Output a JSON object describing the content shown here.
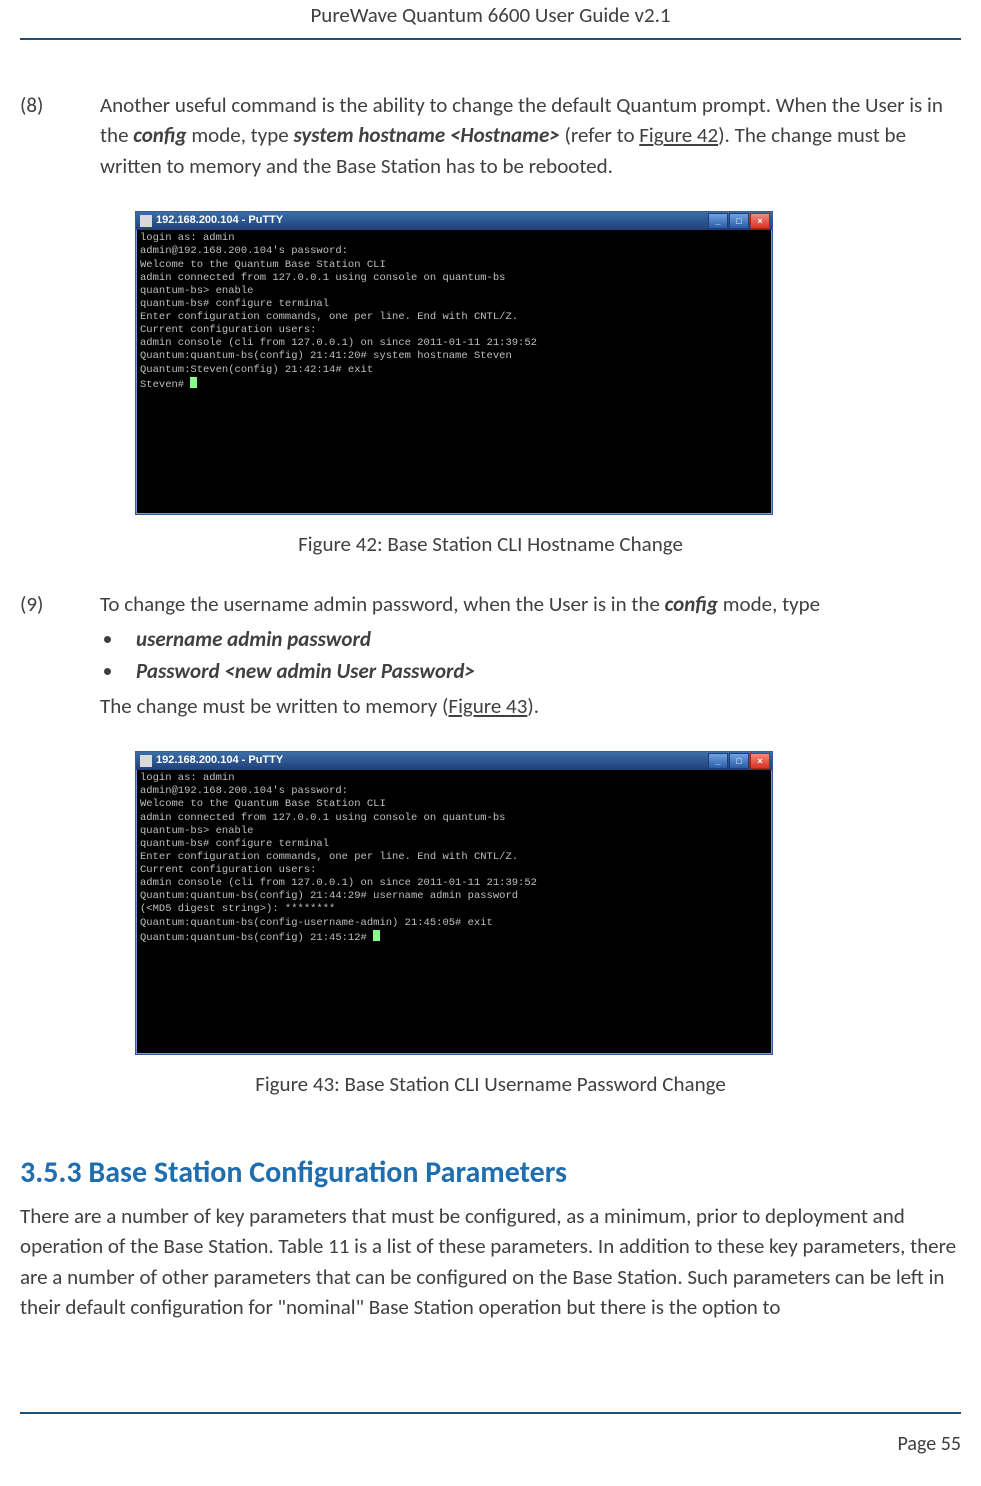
{
  "header": {
    "title": "PureWave Quantum 6600 User Guide v2.1"
  },
  "item8": {
    "num": "(8)",
    "text_pre": "Another useful command is the ability to change the default Quantum prompt. When the User is in the ",
    "config": "config",
    "text_mid": " mode, type ",
    "cmd": "system hostname <Hostname>",
    "text_refer": " (refer to ",
    "figlink": "Figure 42",
    "text_post": "). The change must be written to memory and the Base Station has to be rebooted."
  },
  "putty42": {
    "title": "192.168.200.104 - PuTTY",
    "lines": "login as: admin\nadmin@192.168.200.104's password:\nWelcome to the Quantum Base Station CLI\nadmin connected from 127.0.0.1 using console on quantum-bs\nquantum-bs> enable\nquantum-bs# configure terminal\nEnter configuration commands, one per line. End with CNTL/Z.\nCurrent configuration users:\nadmin console (cli from 127.0.0.1) on since 2011-01-11 21:39:52\nQuantum:quantum-bs(config) 21:41:20# system hostname Steven\nQuantum:Steven(config) 21:42:14# exit\nSteven# "
  },
  "caption42": "Figure 42: Base Station CLI Hostname Change",
  "item9": {
    "num": "(9)",
    "text_pre": "To change the username admin password, when the User is in the ",
    "config": "config",
    "text_post": " mode, type",
    "bullet1": "username admin password",
    "bullet2": "Password <new admin User Password>",
    "tail_pre": "The change must be written to memory (",
    "figlink": "Figure 43",
    "tail_post": ")."
  },
  "putty43": {
    "title": "192.168.200.104 - PuTTY",
    "lines": "login as: admin\nadmin@192.168.200.104's password:\nWelcome to the Quantum Base Station CLI\nadmin connected from 127.0.0.1 using console on quantum-bs\nquantum-bs> enable\nquantum-bs# configure terminal\nEnter configuration commands, one per line. End with CNTL/Z.\nCurrent configuration users:\nadmin console (cli from 127.0.0.1) on since 2011-01-11 21:39:52\nQuantum:quantum-bs(config) 21:44:29# username admin password\n(<MD5 digest string>): ********\nQuantum:quantum-bs(config-username-admin) 21:45:05# exit\nQuantum:quantum-bs(config) 21:45:12# "
  },
  "caption43": "Figure 43: Base Station CLI Username Password Change",
  "section": {
    "heading": "3.5.3 Base Station Configuration Parameters",
    "para": "There are a number of key parameters that must be configured, as a minimum, prior to deployment and operation of the Base Station. Table 11 is a list of these parameters. In addition to these key parameters, there are a number of other parameters that can be configured on the Base Station. Such parameters can be left in their default configuration for \"nominal\" Base Station operation but there is the option to"
  },
  "footer": {
    "page": "Page 55"
  }
}
